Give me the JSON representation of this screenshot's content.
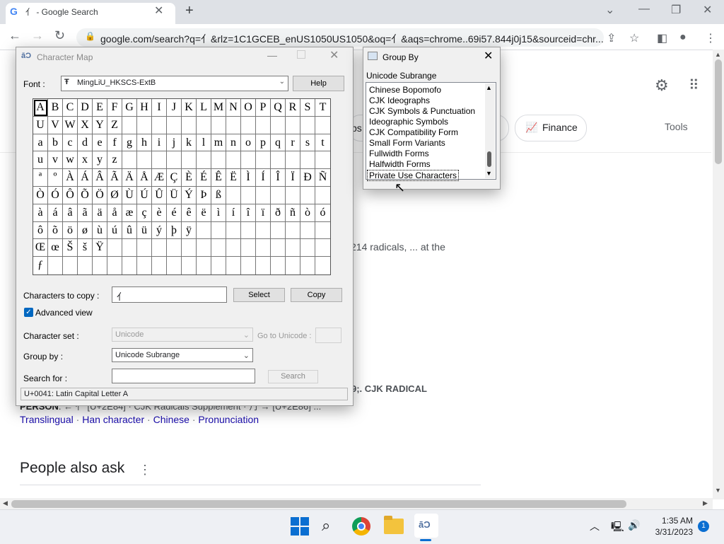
{
  "browser": {
    "tab_favicon": "G",
    "tab_title": "⺅ - Google Search",
    "url": "google.com/search?q=⺅&rlz=1C1GCEB_enUS1050US1050&oq=⺅&aqs=chrome..69i57.844j0j15&sourceid=chr..."
  },
  "google": {
    "chip_partial": "ps",
    "chip_finance": "Finance",
    "tools": "Tools",
    "snippet1": "214 radicals, ... at the",
    "snippet2": "9;. CJK RADICAL",
    "snippet3_bold": "PERSON",
    "snippet3_rest": ". ← ⺅ [U+2E84] · CJK Radicals Supplement · ⺆ → [U+2E86] ...",
    "links": [
      "Translingual",
      "Han character",
      "Chinese",
      "Pronunciation"
    ],
    "people_also_ask": "People also ask"
  },
  "charmap": {
    "title": "Character Map",
    "font_label": "Font :",
    "font_value": "MingLiU_HKSCS-ExtB",
    "help_label": "Help",
    "grid": [
      [
        "A",
        "B",
        "C",
        "D",
        "E",
        "F",
        "G",
        "H",
        "I",
        "J",
        "K",
        "L",
        "M",
        "N",
        "O",
        "P",
        "Q",
        "R",
        "S",
        "T"
      ],
      [
        "U",
        "V",
        "W",
        "X",
        "Y",
        "Z",
        "",
        "",
        "",
        "",
        "",
        "",
        "",
        "",
        "",
        "",
        "",
        "",
        "",
        ""
      ],
      [
        "a",
        "b",
        "c",
        "d",
        "e",
        "f",
        "g",
        "h",
        "i",
        "j",
        "k",
        "l",
        "m",
        "n",
        "o",
        "p",
        "q",
        "r",
        "s",
        "t"
      ],
      [
        "u",
        "v",
        "w",
        "x",
        "y",
        "z",
        "",
        "",
        "",
        "",
        "",
        "",
        "",
        "",
        "",
        "",
        "",
        "",
        "",
        ""
      ],
      [
        "ª",
        "º",
        "À",
        "Á",
        "Â",
        "Ã",
        "Ä",
        "Å",
        "Æ",
        "Ç",
        "È",
        "É",
        "Ê",
        "Ë",
        "Ì",
        "Í",
        "Î",
        "Ï",
        "Ð",
        "Ñ"
      ],
      [
        "Ò",
        "Ó",
        "Ô",
        "Õ",
        "Ö",
        "Ø",
        "Ù",
        "Ú",
        "Û",
        "Ü",
        "Ý",
        "Þ",
        "ß",
        "",
        "",
        "",
        "",
        "",
        "",
        ""
      ],
      [
        "à",
        "á",
        "â",
        "ã",
        "ä",
        "å",
        "æ",
        "ç",
        "è",
        "é",
        "ê",
        "ë",
        "ì",
        "í",
        "î",
        "ï",
        "ð",
        "ñ",
        "ò",
        "ó"
      ],
      [
        "ô",
        "õ",
        "ö",
        "ø",
        "ù",
        "ú",
        "û",
        "ü",
        "ý",
        "þ",
        "ÿ",
        "",
        "",
        "",
        "",
        "",
        "",
        "",
        "",
        ""
      ],
      [
        "Œ",
        "œ",
        "Š",
        "š",
        "Ÿ",
        "",
        "",
        "",
        "",
        "",
        "",
        "",
        "",
        "",
        "",
        "",
        "",
        "",
        "",
        ""
      ],
      [
        "ƒ",
        "",
        "",
        "",
        "",
        "",
        "",
        "",
        "",
        "",
        "",
        "",
        "",
        "",
        "",
        "",
        "",
        "",
        "",
        ""
      ]
    ],
    "selected_char": "A",
    "copy_label": "Characters to copy :",
    "copy_value": "⺅",
    "select_label": "Select",
    "copy_button": "Copy",
    "advanced_view_label": "Advanced view",
    "advanced_view_checked": true,
    "charset_label": "Character set :",
    "charset_value": "Unicode",
    "goto_label": "Go to Unicode :",
    "groupby_label": "Group by :",
    "groupby_value": "Unicode Subrange",
    "search_label": "Search for :",
    "search_button": "Search",
    "status": "U+0041: Latin Capital Letter A"
  },
  "groupby_window": {
    "title": "Group By",
    "subtitle": "Unicode Subrange",
    "items": [
      "Chinese Bopomofo",
      "CJK Ideographs",
      "CJK Symbols & Punctuation",
      "Ideographic Symbols",
      "CJK Compatibility Form",
      "Small Form Variants",
      "Fullwidth Forms",
      "Halfwidth Forms",
      "Private Use Characters"
    ],
    "selected_item": "Private Use Characters"
  },
  "taskbar": {
    "time": "1:35 AM",
    "date": "3/31/2023",
    "notification_count": "1"
  },
  "colors": {
    "accent": "#0067c0",
    "link": "#1a0dab",
    "finance_icon": "#1a73e8"
  }
}
